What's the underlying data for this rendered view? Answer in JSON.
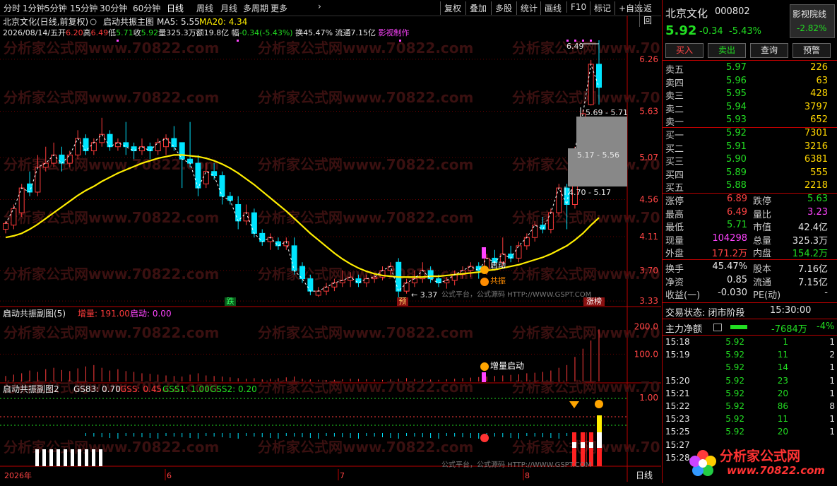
{
  "topbar": {
    "periods": [
      "分时",
      "1分钟",
      "5分钟",
      "15分钟",
      "30分钟",
      "60分钟",
      "日线",
      "周线",
      "月线",
      "多周期",
      "更多"
    ],
    "active": "日线",
    "more_arrow": "›",
    "right_buttons": [
      "复权",
      "叠加",
      "多股",
      "统计",
      "画线",
      "F10",
      "标记",
      "+自选",
      "返回"
    ]
  },
  "main": {
    "title": "北京文化(日线,前复权)",
    "indicator": "启动共振主图",
    "ma5": "MA5: 5.55",
    "ma20": "MA20: 4.34",
    "info": {
      "date": "2026/08/14/五",
      "open_label": "开",
      "open": "6.20",
      "high_label": "高",
      "high": "6.49",
      "low_label": "低",
      "low": "5.71",
      "close_label": "收",
      "close": "5.92",
      "amount_label": "量",
      "amount": "325.3万",
      "money_label": "额",
      "money": "19.8亿",
      "change_label": "幅",
      "change": "-0.34(-5.43%)",
      "turnover_label": "换",
      "turnover": "45.47%",
      "float_label": "流通",
      "float": "7.15亿",
      "author": "影视制作"
    },
    "price_axis": [
      "6.26",
      "5.63",
      "5.07",
      "4.56",
      "4.11",
      "3.70",
      "3.33"
    ],
    "annotations": {
      "top_price": "6.49",
      "low_price": "3.37",
      "box1": "5.69 - 5.71",
      "box2": "5.17 - 5.56",
      "box3": "4.70 - 5.17",
      "tag_die": "跌",
      "tag_yu": "预",
      "tag_zt": "涨榜",
      "tag_qidong": "启动",
      "tag_gongzhen": "共振",
      "source": "公式平台，公式源码 HTTP://WWW.GSPT.COM"
    }
  },
  "sub1": {
    "title": "启动共振副图(5)",
    "vol_label": "增量: 191.00",
    "start_label": "启动: 0.00",
    "axis": [
      "200.0",
      "100.0"
    ],
    "tag": "增量启动"
  },
  "sub2": {
    "title": "启动共振副图2",
    "gs83": "GS83: 0.70",
    "gss": "GSS: 0.45",
    "gss1": "GSS1: 1.00",
    "gss2": "GSS2: 0.20",
    "axis": [
      "1.00"
    ],
    "source": "公式平台，公式源码 HTTP://WWW.GSPT.COM"
  },
  "xaxis": [
    "2026年",
    "6",
    "7",
    "8"
  ],
  "xaxis_right": "日线",
  "watermark": "分析家公式网www.70822.com",
  "right": {
    "name": "北京文化",
    "code": "000802",
    "film_badge": "影视院线",
    "price": "5.92",
    "chg": "-0.34",
    "pct": "-5.43%",
    "badge_pct": "-2.82%",
    "buttons": [
      "买入",
      "卖出",
      "查询",
      "预警"
    ],
    "sells": [
      {
        "label": "卖五",
        "price": "5.97",
        "vol": "226"
      },
      {
        "label": "卖四",
        "price": "5.96",
        "vol": "63"
      },
      {
        "label": "卖三",
        "price": "5.95",
        "vol": "428"
      },
      {
        "label": "卖二",
        "price": "5.94",
        "vol": "3797"
      },
      {
        "label": "卖一",
        "price": "5.93",
        "vol": "652"
      }
    ],
    "buys": [
      {
        "label": "买一",
        "price": "5.92",
        "vol": "7301"
      },
      {
        "label": "买二",
        "price": "5.91",
        "vol": "3216"
      },
      {
        "label": "买三",
        "price": "5.90",
        "vol": "6381"
      },
      {
        "label": "买四",
        "price": "5.89",
        "vol": "555"
      },
      {
        "label": "买五",
        "price": "5.88",
        "vol": "2218"
      }
    ],
    "stats": [
      {
        "l1": "涨停",
        "v1": "6.89",
        "c1": "red",
        "l2": "跌停",
        "v2": "5.63",
        "c2": "grn"
      },
      {
        "l1": "最高",
        "v1": "6.49",
        "c1": "red",
        "l2": "量比",
        "v2": "3.23",
        "c2": "mag"
      },
      {
        "l1": "最低",
        "v1": "5.71",
        "c1": "grn",
        "l2": "市值",
        "v2": "42.4亿",
        "c2": "wht"
      },
      {
        "l1": "现量",
        "v1": "104298",
        "c1": "mag",
        "l2": "总量",
        "v2": "325.3万",
        "c2": "wht"
      },
      {
        "l1": "外盘",
        "v1": "171.2万",
        "c1": "red",
        "l2": "内盘",
        "v2": "154.2万",
        "c2": "grn"
      }
    ],
    "stats2": [
      {
        "l1": "换手",
        "v1": "45.47%",
        "l2": "股本",
        "v2": "7.16亿"
      },
      {
        "l1": "净资",
        "v1": "0.85",
        "l2": "流通",
        "v2": "7.15亿"
      },
      {
        "l1": "收益(一)",
        "v1": "-0.030",
        "l2": "PE(动)",
        "v2": "-"
      }
    ],
    "trade_status": "交易状态: 闭市阶段",
    "trade_time": "15:30:00",
    "main_flow_label": "主力净额",
    "main_flow": "-7684万",
    "main_flow_pct": "-4%",
    "ticks": [
      {
        "t": "15:18",
        "p": "5.92",
        "v": "1",
        "n": "1"
      },
      {
        "t": "15:19",
        "p": "5.92",
        "v": "11",
        "n": "2"
      },
      {
        "t": "",
        "p": "5.92",
        "v": "14",
        "n": "1"
      },
      {
        "t": "15:20",
        "p": "5.92",
        "v": "23",
        "n": "1"
      },
      {
        "t": "15:21",
        "p": "5.92",
        "v": "20",
        "n": "1"
      },
      {
        "t": "15:22",
        "p": "5.92",
        "v": "86",
        "n": "8"
      },
      {
        "t": "15:23",
        "p": "5.92",
        "v": "11",
        "n": "1"
      },
      {
        "t": "15:25",
        "p": "5.92",
        "v": "20",
        "n": "1"
      },
      {
        "t": "15:27",
        "p": "",
        "v": "",
        "n": ""
      },
      {
        "t": "15:28",
        "p": "",
        "v": "",
        "n": ""
      }
    ],
    "logo_text": "分析家公式网",
    "logo_url": "www.70822.com"
  },
  "chart_data": {
    "type": "candlestick",
    "candles": [
      [
        4.2,
        4.27,
        4.15,
        4.3
      ],
      [
        4.25,
        4.45,
        4.2,
        4.5
      ],
      [
        4.4,
        4.7,
        4.35,
        4.75
      ],
      [
        4.75,
        4.65,
        4.6,
        4.9
      ],
      [
        4.65,
        4.95,
        4.6,
        5.1
      ],
      [
        4.95,
        5.0,
        4.9,
        5.2
      ],
      [
        5.0,
        5.1,
        4.95,
        5.25
      ],
      [
        5.1,
        5.0,
        4.9,
        5.2
      ],
      [
        5.0,
        5.1,
        4.95,
        5.15
      ],
      [
        5.1,
        5.3,
        5.05,
        5.4
      ],
      [
        5.3,
        5.15,
        5.1,
        5.35
      ],
      [
        5.15,
        5.25,
        5.1,
        5.3
      ],
      [
        5.25,
        5.35,
        5.2,
        5.55
      ],
      [
        5.35,
        5.2,
        5.15,
        5.4
      ],
      [
        5.2,
        5.25,
        5.15,
        5.3
      ],
      [
        5.25,
        5.2,
        5.1,
        5.5
      ],
      [
        5.2,
        5.15,
        5.05,
        5.25
      ],
      [
        5.15,
        5.2,
        5.1,
        5.3
      ],
      [
        5.2,
        5.15,
        5.05,
        5.25
      ],
      [
        5.15,
        5.25,
        5.1,
        5.3
      ],
      [
        5.2,
        5.3,
        5.1,
        5.35
      ],
      [
        5.3,
        5.2,
        5.15,
        5.45
      ],
      [
        5.25,
        5.05,
        4.7,
        5.2
      ],
      [
        5.05,
        5.0,
        4.95,
        5.5
      ],
      [
        5.0,
        4.7,
        4.6,
        5.1
      ],
      [
        4.75,
        4.9,
        4.7,
        5.0
      ],
      [
        4.9,
        4.85,
        4.8,
        5.0
      ],
      [
        4.85,
        4.6,
        4.5,
        4.9
      ],
      [
        4.6,
        4.55,
        4.5,
        4.65
      ],
      [
        4.5,
        4.3,
        4.2,
        4.6
      ],
      [
        4.3,
        4.4,
        4.25,
        4.5
      ],
      [
        4.4,
        4.15,
        4.1,
        4.45
      ],
      [
        4.15,
        4.05,
        4.0,
        4.2
      ],
      [
        4.05,
        4.1,
        3.95,
        4.15
      ],
      [
        4.05,
        4.0,
        3.95,
        4.1
      ],
      [
        4.0,
        4.05,
        3.95,
        4.1
      ],
      [
        4.0,
        3.7,
        3.65,
        4.1
      ],
      [
        3.75,
        3.6,
        3.55,
        3.8
      ],
      [
        3.6,
        3.45,
        3.4,
        3.65
      ],
      [
        3.4,
        3.45,
        3.38,
        3.5
      ],
      [
        3.45,
        3.5,
        3.4,
        3.55
      ],
      [
        3.5,
        3.55,
        3.45,
        3.6
      ],
      [
        3.55,
        3.58,
        3.5,
        3.7
      ],
      [
        3.58,
        3.62,
        3.5,
        3.68
      ],
      [
        3.6,
        3.55,
        3.5,
        3.65
      ],
      [
        3.55,
        3.6,
        3.5,
        3.65
      ],
      [
        3.6,
        3.62,
        3.55,
        3.66
      ],
      [
        3.62,
        3.7,
        3.58,
        3.75
      ],
      [
        3.7,
        3.75,
        3.65,
        3.8
      ],
      [
        3.8,
        3.45,
        3.37,
        3.85
      ],
      [
        3.45,
        3.55,
        3.42,
        3.6
      ],
      [
        3.55,
        3.6,
        3.5,
        3.7
      ],
      [
        3.6,
        3.7,
        3.55,
        3.8
      ],
      [
        3.7,
        3.6,
        3.55,
        3.75
      ],
      [
        3.6,
        3.55,
        3.5,
        3.65
      ],
      [
        3.55,
        3.58,
        3.48,
        3.62
      ],
      [
        3.58,
        3.65,
        3.52,
        3.7
      ],
      [
        3.65,
        3.7,
        3.6,
        3.75
      ],
      [
        3.7,
        3.75,
        3.62,
        3.8
      ],
      [
        3.75,
        3.7,
        3.6,
        3.8
      ],
      [
        3.7,
        3.85,
        3.65,
        3.9
      ],
      [
        3.85,
        3.8,
        3.75,
        3.95
      ],
      [
        3.8,
        3.9,
        3.75,
        4.1
      ],
      [
        3.9,
        3.85,
        3.8,
        4.0
      ],
      [
        3.85,
        4.0,
        3.8,
        4.05
      ],
      [
        4.0,
        4.1,
        3.95,
        4.15
      ],
      [
        4.1,
        4.25,
        4.05,
        4.3
      ],
      [
        4.25,
        4.2,
        4.15,
        4.35
      ],
      [
        4.2,
        4.4,
        4.15,
        4.45
      ],
      [
        4.4,
        4.7,
        4.35,
        4.75
      ],
      [
        4.7,
        4.5,
        4.2,
        4.75
      ],
      [
        4.5,
        5.17,
        4.45,
        5.2
      ],
      [
        5.25,
        5.6,
        5.2,
        5.65
      ],
      [
        5.71,
        6.2,
        5.7,
        6.25
      ],
      [
        6.2,
        5.92,
        5.71,
        6.49
      ]
    ],
    "ma20": [
      4.1,
      4.12,
      4.15,
      4.2,
      4.26,
      4.33,
      4.4,
      4.47,
      4.54,
      4.61,
      4.67,
      4.72,
      4.78,
      4.83,
      4.88,
      4.92,
      4.96,
      5.0,
      5.03,
      5.06,
      5.08,
      5.1,
      5.1,
      5.09,
      5.08,
      5.06,
      5.03,
      4.99,
      4.94,
      4.88,
      4.81,
      4.74,
      4.66,
      4.58,
      4.5,
      4.42,
      4.33,
      4.24,
      4.15,
      4.07,
      3.99,
      3.91,
      3.84,
      3.78,
      3.73,
      3.69,
      3.66,
      3.64,
      3.63,
      3.62,
      3.62,
      3.62,
      3.62,
      3.63,
      3.63,
      3.64,
      3.65,
      3.66,
      3.67,
      3.68,
      3.7,
      3.71,
      3.73,
      3.75,
      3.77,
      3.8,
      3.83,
      3.86,
      3.9,
      3.95,
      4.0,
      4.07,
      4.15,
      4.25,
      4.34
    ],
    "sub1_values": [
      20,
      25,
      30,
      40,
      35,
      45,
      50,
      42,
      38,
      48,
      55,
      60,
      50,
      40,
      45,
      38,
      35,
      30,
      28,
      25,
      22,
      20,
      18,
      25,
      30,
      22,
      20,
      18,
      15,
      12,
      10,
      12,
      8,
      10,
      12,
      15,
      18,
      10,
      8,
      6,
      5,
      6,
      8,
      10,
      9,
      8,
      7,
      6,
      8,
      10,
      12,
      9,
      8,
      7,
      6,
      8,
      10,
      12,
      14,
      16,
      18,
      20,
      22,
      24,
      26,
      30,
      32,
      35,
      40,
      50,
      60,
      90,
      120,
      150,
      191
    ],
    "sub2_values": [
      0.45
    ]
  }
}
